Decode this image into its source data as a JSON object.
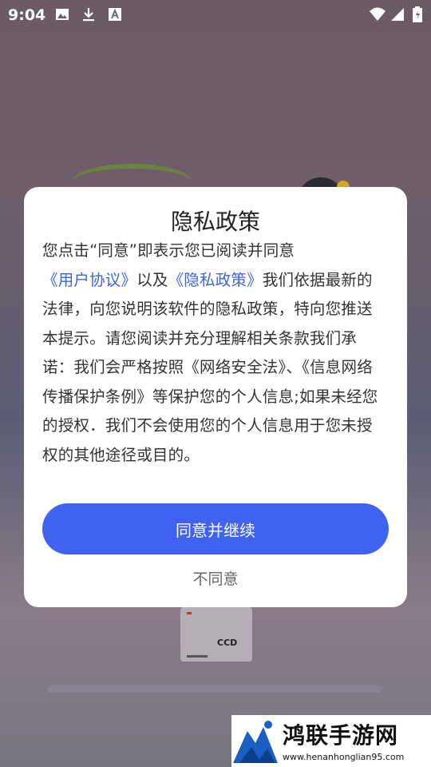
{
  "status_bar": {
    "time": "9:04",
    "left_icons": [
      "image-icon",
      "download-icon",
      "font-icon"
    ],
    "right_icons": [
      "wifi-icon",
      "signal-icon",
      "battery-icon"
    ]
  },
  "background": {
    "device_label": "CCD"
  },
  "dialog": {
    "title": "隐私政策",
    "body": {
      "p1": "您点击“同意”即表示您已阅读并同意",
      "link1": "《用户协议》",
      "p2": "以及",
      "link2": "《隐私政策》",
      "p3": "我们依据最新的法律，向您说明该软件的隐私政策，特向您推送本提示。请您阅读并充分理解相关条款我们承诺：我们会严格按照《网络安全法》、《信息网络传播保护条例》等保护您的个人信息;如果未经您的授权．我们不会使用您的个人信息用于您未授权的其他途径或目的。"
    },
    "agree_button": "同意并继续",
    "disagree_button": "不同意"
  },
  "watermark": {
    "title": "鸿联手游网",
    "url": "www.henanhonglian95.com"
  },
  "colors": {
    "accent": "#3f63f0",
    "link": "#3e63e8"
  }
}
